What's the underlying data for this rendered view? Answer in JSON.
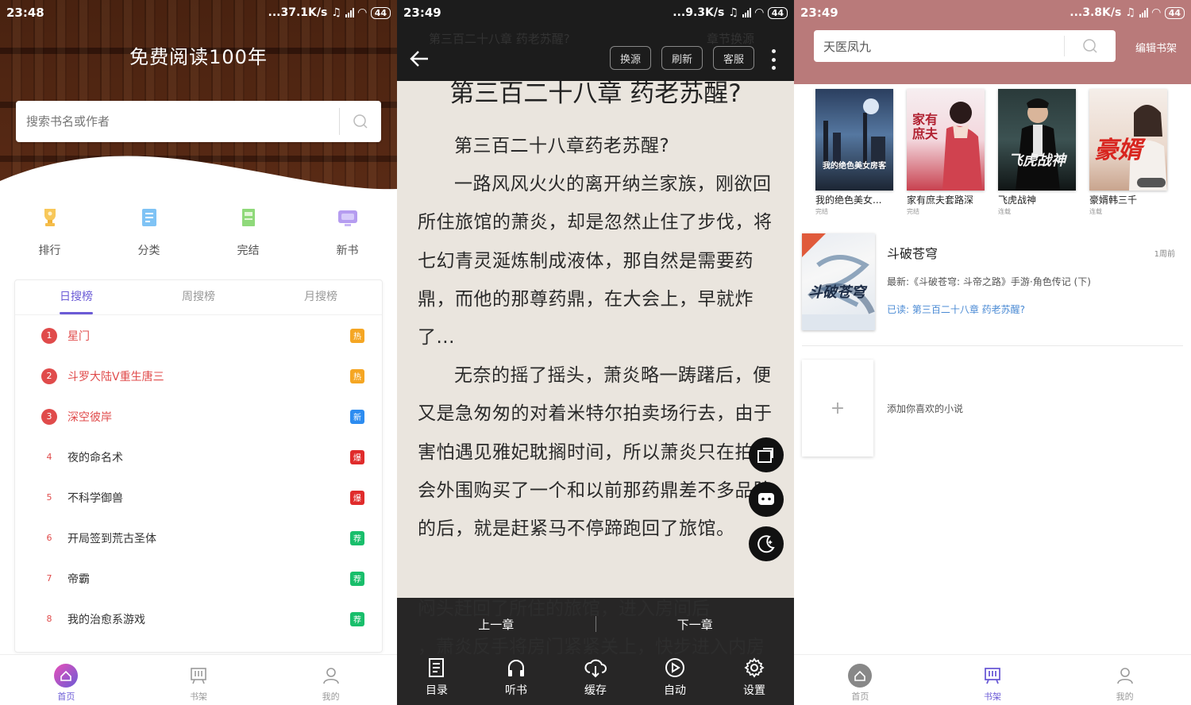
{
  "screen1": {
    "status": {
      "time": "23:48",
      "speed": "...37.1K/s",
      "battery": "44"
    },
    "title": "免费阅读100年",
    "search": {
      "placeholder": "搜索书名或作者"
    },
    "categories": [
      {
        "label": "排行",
        "icon": "trophy-icon"
      },
      {
        "label": "分类",
        "icon": "category-icon"
      },
      {
        "label": "完结",
        "icon": "finished-book-icon"
      },
      {
        "label": "新书",
        "icon": "new-book-icon"
      }
    ],
    "tabs": [
      "日搜榜",
      "周搜榜",
      "月搜榜"
    ],
    "ranking": [
      {
        "rank": "1",
        "name": "星门",
        "badge": "热",
        "badge_color": "#f5a623"
      },
      {
        "rank": "2",
        "name": "斗罗大陆V重生唐三",
        "badge": "热",
        "badge_color": "#f5a623"
      },
      {
        "rank": "3",
        "name": "深空彼岸",
        "badge": "新",
        "badge_color": "#2d8cf0"
      },
      {
        "rank": "4",
        "name": "夜的命名术",
        "badge": "爆",
        "badge_color": "#e02b2b"
      },
      {
        "rank": "5",
        "name": "不科学御兽",
        "badge": "爆",
        "badge_color": "#e02b2b"
      },
      {
        "rank": "6",
        "name": "开局签到荒古圣体",
        "badge": "荐",
        "badge_color": "#19be6b"
      },
      {
        "rank": "7",
        "name": "帝霸",
        "badge": "荐",
        "badge_color": "#19be6b"
      },
      {
        "rank": "8",
        "name": "我的治愈系游戏",
        "badge": "荐",
        "badge_color": "#19be6b"
      }
    ],
    "tabbar": [
      "首页",
      "书架",
      "我的"
    ]
  },
  "screen2": {
    "status": {
      "time": "23:49",
      "speed": "...9.3K/s",
      "battery": "44"
    },
    "ghost_title": "第三百二十八章 药老苏醒?",
    "ghost_right": "章节换源",
    "buttons": [
      "换源",
      "刷新",
      "客服"
    ],
    "chapter_heading": "第三百二十八章 药老苏醒?",
    "paragraphs": [
      "第三百二十八章药老苏醒?",
      "一路风风火火的离开纳兰家族，刚欲回所住旅馆的萧炎，却是忽然止住了步伐，将七幻青灵涎炼制成液体，那自然是需要药鼎，而他的那尊药鼎，在大会上，早就炸了...",
      "无奈的摇了摇头，萧炎略一踌躇后，便又是急匆匆的对着米特尔拍卖场行去，由于害怕遇见雅妃耽搁时间，所以萧炎只在拍卖会外围购买了一个和以前那药鼎差不多品阶的后，就是赶紧马不停蹄跑回了旅馆。"
    ],
    "under_lines": [
      "闷头赶回了所住的旅馆，进入房间后",
      "，萧炎反手将房门紧紧关上，快步进入内房"
    ],
    "prev": "上一章",
    "next": "下一章",
    "tools": [
      {
        "label": "目录",
        "icon": "catalog-icon"
      },
      {
        "label": "听书",
        "icon": "headphones-icon"
      },
      {
        "label": "缓存",
        "icon": "download-icon"
      },
      {
        "label": "自动",
        "icon": "play-icon"
      },
      {
        "label": "设置",
        "icon": "gear-icon"
      }
    ]
  },
  "screen3": {
    "status": {
      "time": "23:49",
      "speed": "...3.8K/s",
      "battery": "44"
    },
    "search_value": "天医凤九",
    "edit": "编辑书架",
    "colors": {
      "header": "#b97a7a",
      "accent": "#6b5bd6",
      "link": "#4a8ad4"
    },
    "recommend": [
      {
        "name": "我的绝色美女...",
        "status": "完结",
        "cover_text": "我的绝色美女房客"
      },
      {
        "name": "家有庶夫套路深",
        "status": "完结",
        "cover_text": "家有庶夫"
      },
      {
        "name": "飞虎战神",
        "status": "连载",
        "cover_text": "飞虎战神"
      },
      {
        "name": "豪婿韩三千",
        "status": "连载",
        "cover_text": "豪婿"
      }
    ],
    "shelf": {
      "title": "斗破苍穹",
      "time": "1周前",
      "latest": "最新:《斗破苍穹: 斗帝之路》手游·角色传记 (下)",
      "read": "已读: 第三百二十八章 药老苏醒?",
      "cover_text": "斗破苍穹"
    },
    "add_symbol": "+",
    "add_label": "添加你喜欢的小说",
    "tabbar": [
      "首页",
      "书架",
      "我的"
    ]
  }
}
